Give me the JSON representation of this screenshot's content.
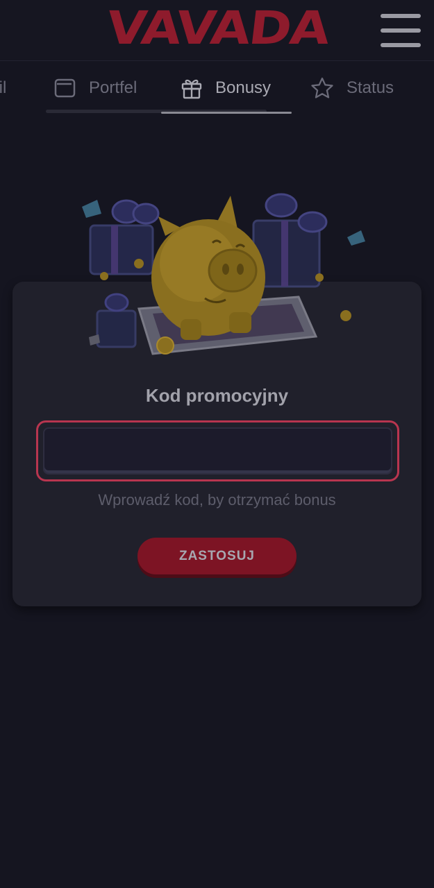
{
  "header": {
    "logo_text": "VAVADA",
    "menu_icon": "hamburger-menu-icon"
  },
  "tabs": [
    {
      "label": "fil",
      "icon": "user-icon",
      "active": false
    },
    {
      "label": "Portfel",
      "icon": "wallet-icon",
      "active": false
    },
    {
      "label": "Bonusy",
      "icon": "gift-icon",
      "active": true
    },
    {
      "label": "Status",
      "icon": "star-icon",
      "active": false
    }
  ],
  "promo": {
    "illustration": "piggy-bank-gifts-illustration",
    "title": "Kod promocyjny",
    "input_value": "",
    "input_placeholder": "",
    "hint": "Wprowadź kod, by otrzymać bonus",
    "apply_label": "ZASTOSUJ"
  },
  "colors": {
    "background": "#151520",
    "card": "#20202b",
    "brand_red": "#8e1b2c",
    "input_focus_border": "#b8354f",
    "button": "#7d1424"
  }
}
